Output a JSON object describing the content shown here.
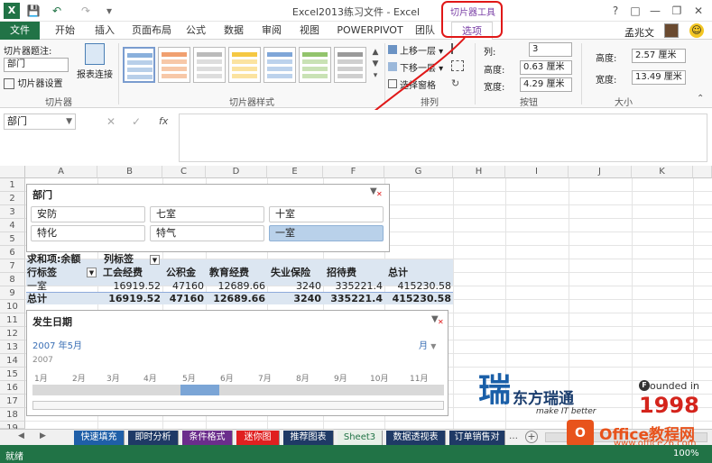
{
  "titlebar": {
    "title": "Excel2013练习文件 - Excel",
    "contextual_group": "切片器工具",
    "help": "?",
    "icons": [
      "save-icon",
      "undo-icon",
      "redo-icon",
      "customize-icon"
    ]
  },
  "tabs": [
    "文件",
    "开始",
    "插入",
    "页面布局",
    "公式",
    "数据",
    "审阅",
    "视图",
    "POWERPIVOT",
    "团队",
    "选项"
  ],
  "user": {
    "name": "孟兆文"
  },
  "ribbon": {
    "caption_label": "切片器题注:",
    "caption_value": "部门",
    "slicer_settings": "切片器设置",
    "report_connections": "报表连接",
    "group_slicer": "切片器",
    "group_styles": "切片器样式",
    "bring_forward": "上移一层",
    "send_backward": "下移一层",
    "selection_pane": "选择窗格",
    "group_arrange": "排列",
    "columns_label": "列:",
    "columns_value": "3",
    "btn_height_label": "高度:",
    "btn_height_value": "0.63 厘米",
    "btn_width_label": "宽度:",
    "btn_width_value": "4.29 厘米",
    "group_buttons": "按钮",
    "height_label": "高度:",
    "height_value": "2.57 厘米",
    "width_label": "宽度:",
    "width_value": "13.49 厘米",
    "group_size": "大小"
  },
  "formula_bar": {
    "name_box": "部门",
    "fx": "fx",
    "formula": ""
  },
  "columns": [
    "A",
    "B",
    "C",
    "D",
    "E",
    "F",
    "G",
    "H",
    "I",
    "J",
    "K"
  ],
  "rows": [
    "1",
    "2",
    "3",
    "4",
    "5",
    "6",
    "7",
    "8",
    "9",
    "10",
    "11",
    "12",
    "13",
    "14",
    "15",
    "16",
    "17",
    "18",
    "19"
  ],
  "slicer_dept": {
    "title": "部门",
    "items": [
      "安防",
      "七室",
      "十室",
      "特化",
      "特气",
      "一室"
    ],
    "selected": "一室"
  },
  "pivot": {
    "r7_a": "求和项:余额",
    "r7_b": "列标签",
    "headers": [
      "行标签",
      "工会经费",
      "公积金",
      "教育经费",
      "失业保险",
      "招待费",
      "总计"
    ],
    "row9": [
      "一室",
      "16919.52",
      "47160",
      "12689.66",
      "3240",
      "335221.4",
      "415230.58"
    ],
    "row10": [
      "总计",
      "16919.52",
      "47160",
      "12689.66",
      "3240",
      "335221.4",
      "415230.58"
    ]
  },
  "timeline": {
    "title": "发生日期",
    "period": "2007 年5月",
    "level": "月",
    "year": "2007",
    "months": [
      "1月",
      "2月",
      "3月",
      "4月",
      "5月",
      "6月",
      "7月",
      "8月",
      "9月",
      "10月",
      "11月"
    ],
    "selected_month": "5月"
  },
  "watermark": {
    "brand": "东方瑞通",
    "slogan": "make IT better",
    "founded": "ounded in",
    "year": "1998",
    "office_brand": "Office教程网",
    "office_url": "www.office26.com"
  },
  "sheet_tabs": [
    {
      "label": "快速填充",
      "color": "#1f5fa8"
    },
    {
      "label": "即时分析",
      "color": "#1f3a66"
    },
    {
      "label": "条件格式",
      "color": "#6b2d8c"
    },
    {
      "label": "迷你图",
      "color": "#e02020"
    },
    {
      "label": "推荐图表",
      "color": "#1f3a66"
    },
    {
      "label": "Sheet3",
      "color": "#e8f0e8"
    },
    {
      "label": "数据透视表",
      "color": "#1f3a66"
    },
    {
      "label": "订单销售对",
      "color": "#1f3a66"
    }
  ],
  "status": {
    "ready": "就绪",
    "zoom": "100%"
  },
  "colors": {
    "excel_green": "#217346",
    "slicer_selected": "#b9d1ea",
    "context_tab": "#7a3fa6",
    "highlight_ring": "#e01818"
  }
}
